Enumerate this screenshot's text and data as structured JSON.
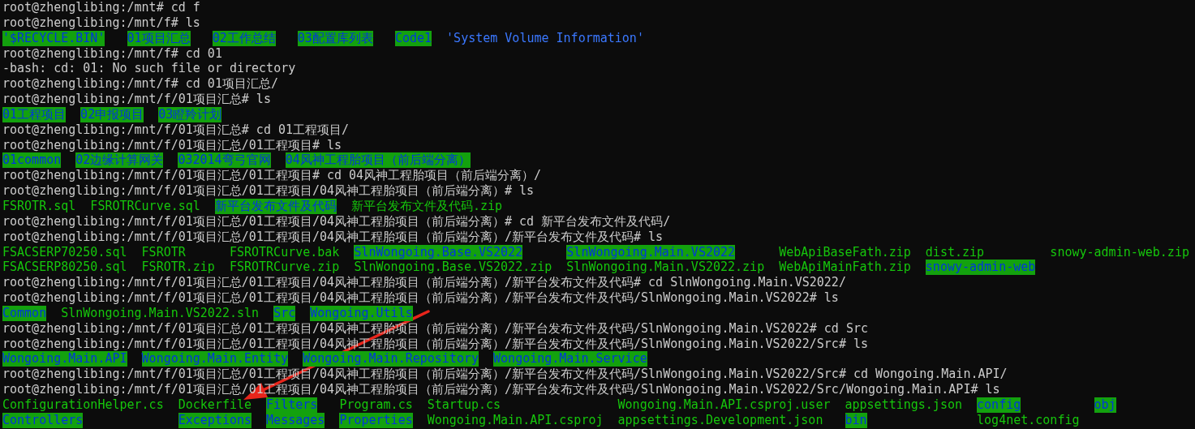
{
  "terminal": {
    "lines": [
      {
        "kind": "command",
        "text": "root@zhenglibing:/mnt# cd f"
      },
      {
        "kind": "command",
        "text": "root@zhenglibing:/mnt/f# ls"
      },
      {
        "kind": "listing",
        "rows": [
          [
            {
              "name": "'$RECYCLE.BIN'",
              "kind": "dir"
            },
            {
              "name": "01项目汇总",
              "kind": "dir"
            },
            {
              "name": "02工作总结",
              "kind": "dir"
            },
            {
              "name": "03配置库列表",
              "kind": "dir"
            },
            {
              "name": "Code1",
              "kind": "dir"
            },
            {
              "name": "'System Volume Information'",
              "kind": "quoted"
            }
          ]
        ]
      },
      {
        "kind": "command",
        "text": "root@zhenglibing:/mnt/f# cd 01"
      },
      {
        "kind": "output",
        "text": "-bash: cd: 01: No such file or directory"
      },
      {
        "kind": "command",
        "text": "root@zhenglibing:/mnt/f# cd 01项目汇总/"
      },
      {
        "kind": "command",
        "text": "root@zhenglibing:/mnt/f/01项目汇总# ls"
      },
      {
        "kind": "listing",
        "rows": [
          [
            {
              "name": "01工程项目",
              "kind": "dir"
            },
            {
              "name": "02申报项目",
              "kind": "dir"
            },
            {
              "name": "03瞪羚计划",
              "kind": "dir"
            }
          ]
        ]
      },
      {
        "kind": "command",
        "text": "root@zhenglibing:/mnt/f/01项目汇总# cd 01工程项目/"
      },
      {
        "kind": "command",
        "text": "root@zhenglibing:/mnt/f/01项目汇总/01工程项目# ls"
      },
      {
        "kind": "listing",
        "rows": [
          [
            {
              "name": "01common",
              "kind": "dir"
            },
            {
              "name": "02边缘计算网关",
              "kind": "dir"
            },
            {
              "name": "032014弯弓官网",
              "kind": "dir"
            },
            {
              "name": "04风神工程胎项目（前后端分离）",
              "kind": "dir"
            }
          ]
        ]
      },
      {
        "kind": "command",
        "text": "root@zhenglibing:/mnt/f/01项目汇总/01工程项目# cd 04风神工程胎项目（前后端分离）/"
      },
      {
        "kind": "command",
        "text": "root@zhenglibing:/mnt/f/01项目汇总/01工程项目/04风神工程胎项目（前后端分离）# ls"
      },
      {
        "kind": "listing",
        "rows": [
          [
            {
              "name": "FSROTR.sql",
              "kind": "file"
            },
            {
              "name": "FSROTRCurve.sql",
              "kind": "file"
            },
            {
              "name": "新平台发布文件及代码",
              "kind": "dir"
            },
            {
              "name": "新平台发布文件及代码.zip",
              "kind": "file"
            }
          ]
        ]
      },
      {
        "kind": "command",
        "text": "root@zhenglibing:/mnt/f/01项目汇总/01工程项目/04风神工程胎项目（前后端分离）# cd 新平台发布文件及代码/"
      },
      {
        "kind": "command",
        "text": "root@zhenglibing:/mnt/f/01项目汇总/01工程项目/04风神工程胎项目（前后端分离）/新平台发布文件及代码# ls"
      },
      {
        "kind": "listing",
        "rows": [
          [
            {
              "name": "FSACSERP70250.sql",
              "kind": "file"
            },
            {
              "name": "FSROTR",
              "kind": "file"
            },
            {
              "name": "FSROTRCurve.bak",
              "kind": "file"
            },
            {
              "name": "SlnWongoing.Base.VS2022",
              "kind": "dir"
            },
            {
              "name": "SlnWongoing.Main.VS2022",
              "kind": "dir"
            },
            {
              "name": "WebApiBaseFath.zip",
              "kind": "file"
            },
            {
              "name": "dist.zip",
              "kind": "file"
            },
            {
              "name": "snowy-admin-web.zip",
              "kind": "file"
            }
          ],
          [
            {
              "name": "FSACSERP80250.sql",
              "kind": "file"
            },
            {
              "name": "FSROTR.zip",
              "kind": "file"
            },
            {
              "name": "FSROTRCurve.zip",
              "kind": "file"
            },
            {
              "name": "SlnWongoing.Base.VS2022.zip",
              "kind": "file"
            },
            {
              "name": "SlnWongoing.Main.VS2022.zip",
              "kind": "file"
            },
            {
              "name": "WebApiMainFath.zip",
              "kind": "file"
            },
            {
              "name": "snowy-admin-web",
              "kind": "dir"
            }
          ]
        ]
      },
      {
        "kind": "command",
        "text": "root@zhenglibing:/mnt/f/01项目汇总/01工程项目/04风神工程胎项目（前后端分离）/新平台发布文件及代码# cd SlnWongoing.Main.VS2022/"
      },
      {
        "kind": "command",
        "text": "root@zhenglibing:/mnt/f/01项目汇总/01工程项目/04风神工程胎项目（前后端分离）/新平台发布文件及代码/SlnWongoing.Main.VS2022# ls"
      },
      {
        "kind": "listing",
        "rows": [
          [
            {
              "name": "Common",
              "kind": "dir"
            },
            {
              "name": "SlnWongoing.Main.VS2022.sln",
              "kind": "file"
            },
            {
              "name": "Src",
              "kind": "dir"
            },
            {
              "name": "Wongoing.Utils",
              "kind": "dir"
            }
          ]
        ]
      },
      {
        "kind": "command",
        "text": "root@zhenglibing:/mnt/f/01项目汇总/01工程项目/04风神工程胎项目（前后端分离）/新平台发布文件及代码/SlnWongoing.Main.VS2022# cd Src"
      },
      {
        "kind": "command",
        "text": "root@zhenglibing:/mnt/f/01项目汇总/01工程项目/04风神工程胎项目（前后端分离）/新平台发布文件及代码/SlnWongoing.Main.VS2022/Src# ls"
      },
      {
        "kind": "listing",
        "rows": [
          [
            {
              "name": "Wongoing.Main.API",
              "kind": "dir"
            },
            {
              "name": "Wongoing.Main.Entity",
              "kind": "dir"
            },
            {
              "name": "Wongoing.Main.Repository",
              "kind": "dir"
            },
            {
              "name": "Wongoing.Main.Service",
              "kind": "dir"
            }
          ]
        ]
      },
      {
        "kind": "command",
        "text": "root@zhenglibing:/mnt/f/01项目汇总/01工程项目/04风神工程胎项目（前后端分离）/新平台发布文件及代码/SlnWongoing.Main.VS2022/Src# cd Wongoing.Main.API/"
      },
      {
        "kind": "command",
        "text": "root@zhenglibing:/mnt/f/01项目汇总/01工程项目/04风神工程胎项目（前后端分离）/新平台发布文件及代码/SlnWongoing.Main.VS2022/Src/Wongoing.Main.API# ls"
      },
      {
        "kind": "listing",
        "rows": [
          [
            {
              "name": "ConfigurationHelper.cs",
              "kind": "file"
            },
            {
              "name": "Dockerfile",
              "kind": "file"
            },
            {
              "name": "Filters",
              "kind": "dir"
            },
            {
              "name": "Program.cs",
              "kind": "file"
            },
            {
              "name": "Startup.cs",
              "kind": "file"
            },
            {
              "name": "Wongoing.Main.API.csproj.user",
              "kind": "file"
            },
            {
              "name": "appsettings.json",
              "kind": "file"
            },
            {
              "name": "config",
              "kind": "dir"
            },
            {
              "name": "obj",
              "kind": "dir"
            }
          ],
          [
            {
              "name": "Controllers",
              "kind": "dir"
            },
            {
              "name": "Exceptions",
              "kind": "dir"
            },
            {
              "name": "Messages",
              "kind": "dir"
            },
            {
              "name": "Properties",
              "kind": "dir"
            },
            {
              "name": "Wongoing.Main.API.csproj",
              "kind": "file"
            },
            {
              "name": "appsettings.Development.json",
              "kind": "file"
            },
            {
              "name": "bin",
              "kind": "dir"
            },
            {
              "name": "log4net.config",
              "kind": "file"
            }
          ]
        ]
      }
    ]
  }
}
